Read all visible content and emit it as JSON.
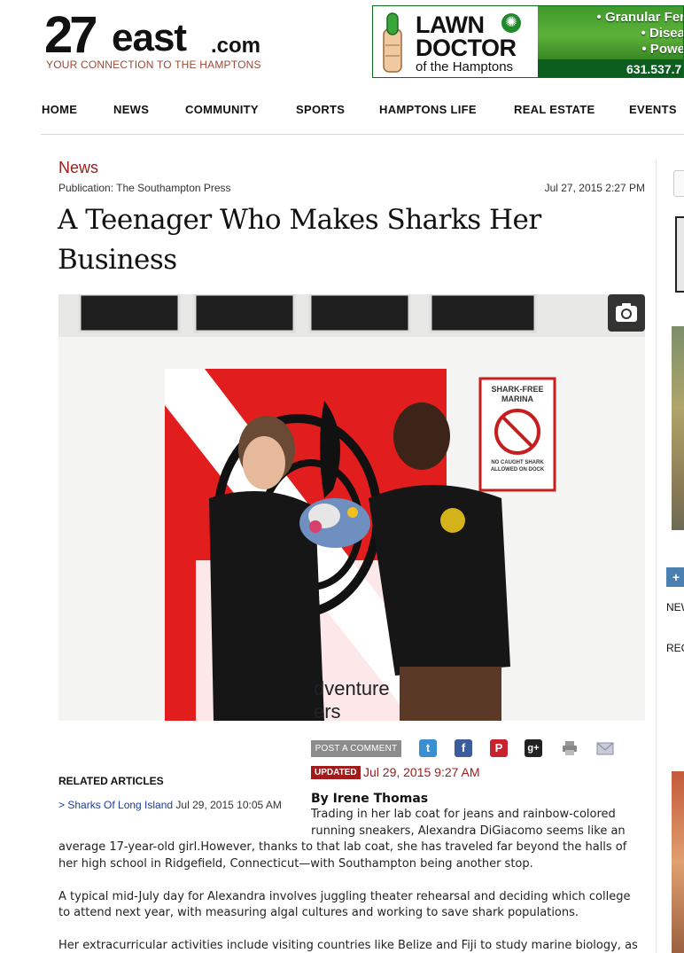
{
  "header": {
    "logo_27": "27",
    "logo_east": "east",
    "logo_com": ".com",
    "tagline": "YOUR CONNECTION TO THE HAMPTONS"
  },
  "ad": {
    "brand_line1": "LAWN",
    "brand_line2": "DOCTOR",
    "brand_line3": "of the Hamptons",
    "bullets": [
      "• Granular Fer",
      "• Disea",
      "• Powe"
    ],
    "phone": "631.537.7",
    "colors": {
      "green": "#0b5e1e"
    }
  },
  "nav": {
    "items": [
      "HOME",
      "NEWS",
      "COMMUNITY",
      "SPORTS",
      "HAMPTONS LIFE",
      "REAL ESTATE",
      "EVENTS"
    ]
  },
  "sidebar": {
    "plus": "+",
    "text1": "NEW",
    "text2": "REC"
  },
  "article": {
    "section": "News",
    "publication": "Publication: The Southampton Press",
    "date": "Jul 27, 2015 2:27 PM",
    "headline": "A Teenager Who Makes Sharks Her Business",
    "photo_sign_text": "SHARK-FREE MARINA",
    "photo_sign_sub": "NO CAUGHT SHARK ALLOWED ON DOCK",
    "photo_banner_text": "dventure",
    "photo_banner_text2": "ers",
    "post_comment": "POST A COMMENT",
    "share_icons": [
      "twitter-icon",
      "facebook-icon",
      "pinterest-icon",
      "googleplus-icon",
      "print-icon",
      "email-icon"
    ],
    "updated_label": "UPDATED",
    "updated_date": "Jul 29, 2015 9:27 AM",
    "byline": "By Irene Thomas",
    "para1_lines": [
      "Trading in her lab coat for jeans and rainbow-colored",
      "running sneakers, Alexandra DiGiacomo seems like an"
    ],
    "para1_rest": [
      "average 17-year-old girl.However, thanks to that lab coat, she has traveled far beyond the halls of",
      "her high school in Ridgefield, Connecticut—with Southampton being another stop."
    ],
    "para2": [
      "A typical mid-July day for Alexandra involves juggling theater rehearsal and deciding which college",
      "to attend next year, with measuring algal cultures and working to save shark populations."
    ],
    "para3": [
      "Her extracurricular activities include visiting countries like Belize and Fiji to study marine biology, as"
    ],
    "accent_color": "#a01c1c"
  },
  "related": {
    "title": "RELATED ARTICLES",
    "items": [
      {
        "label": "> Sharks Of Long Island",
        "date": "Jul 29, 2015 10:05 AM"
      }
    ]
  }
}
